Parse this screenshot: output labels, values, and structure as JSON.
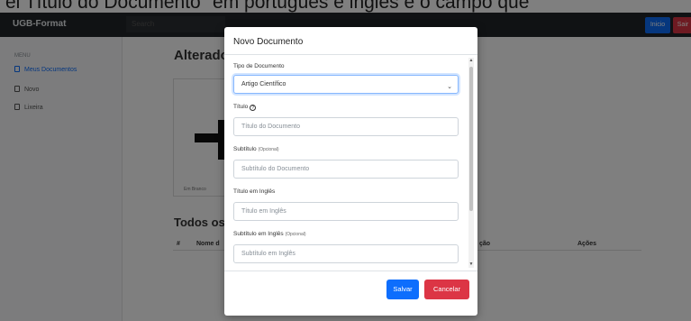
{
  "caption": {
    "text": "el Título do Documento\" em português e inglês e o campo que"
  },
  "navbar": {
    "brand": "UGB-Format",
    "search_placeholder": "Search",
    "login_label": "Inicio",
    "logout_label": "Sair"
  },
  "sidebar": {
    "menu_label": "MENU",
    "items": [
      {
        "label": "Meus Documentos",
        "active": true,
        "icon": "document-icon"
      },
      {
        "label": "Novo",
        "active": false,
        "icon": "file-icon"
      },
      {
        "label": "Lixeira",
        "active": false,
        "icon": "trash-icon"
      }
    ]
  },
  "main": {
    "title": "Alterado",
    "blank_label": "Em Branco",
    "section_title": "Todos os",
    "table_headers": [
      "#",
      "Nome d",
      "ção",
      "Ações"
    ]
  },
  "modal": {
    "title": "Novo Documento",
    "doc_type": {
      "label": "Tipo de Documento",
      "value": "Artigo Científico"
    },
    "title_field": {
      "label": "Título",
      "placeholder": "Título do Documento"
    },
    "subtitle_field": {
      "label": "Subtítulo",
      "optional": "(Opcional)",
      "placeholder": "Subtítulo do Documento"
    },
    "title_en_field": {
      "label": "Título em Inglês",
      "placeholder": "Título em Inglês"
    },
    "subtitle_en_field": {
      "label": "Subtítulo em Inglês",
      "optional": "(Opcional)",
      "placeholder": "Subtítulo em Inglês"
    },
    "save_label": "Salvar",
    "cancel_label": "Cancelar"
  },
  "colors": {
    "primary": "#0d6efd",
    "danger": "#dc3545",
    "navbar": "#212529"
  }
}
